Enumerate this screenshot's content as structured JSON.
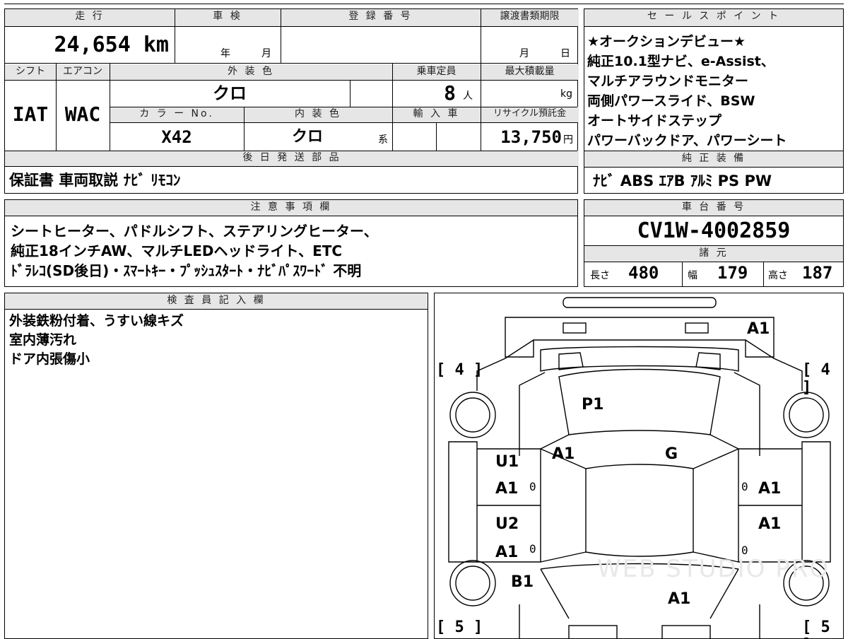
{
  "top": {
    "mileage_label": "走 行",
    "mileage_value": "24,654 km",
    "inspection_label": "車 検",
    "inspection_year": "年",
    "inspection_month": "月",
    "registration_label": "登 録 番 号",
    "transfer_label": "譲渡書類期限",
    "transfer_month": "月",
    "transfer_day": "日"
  },
  "specs": {
    "shift_label": "シフト",
    "ac_label": "エアコン",
    "exterior_label": "外 装 色",
    "capacity_label": "乗車定員",
    "maxload_label": "最大積載量",
    "shift_value": "IAT",
    "ac_value": "WAC",
    "exterior_value": "クロ",
    "capacity_value": "8",
    "capacity_unit": "人",
    "maxload_unit": "kg",
    "color_no_label": "カ ラ ー No.",
    "interior_label": "内 装 色",
    "import_label": "輸 入 車",
    "recycle_label": "リサイクル預託金",
    "color_no_value": "X42",
    "interior_value": "クロ",
    "interior_suffix": "系",
    "recycle_value": "13,750",
    "recycle_unit": "円"
  },
  "later_parts": {
    "label": "後 日 発 送 部 品",
    "items": "保証書 車両取説 ﾅﾋﾞ ﾘﾓｺﾝ"
  },
  "sales_point": {
    "label": "セ ー ル ス ポ イ ン ト",
    "lines": [
      "★オークションデビュー★",
      "純正10.1型ナビ、e-Assist、",
      "マルチアラウンドモニター",
      "両側パワースライド、BSW",
      "オートサイドステップ",
      "パワーバックドア、パワーシート"
    ]
  },
  "equipment": {
    "label": "純 正 装 備",
    "items": "ﾅﾋﾞ ABS ｴｱB ｱﾙﾐ PS PW"
  },
  "notes": {
    "label": "注 意 事 項 欄",
    "lines": [
      "シートヒーター、パドルシフト、ステアリングヒーター、",
      "純正18インチAW、マルチLEDヘッドライト、ETC",
      "ﾄﾞﾗﾚｺ(SD後日)・ｽﾏｰﾄｷｰ・ﾌﾟｯｼｭｽﾀｰﾄ・ﾅﾋﾞﾊﾟｽﾜｰﾄﾞ 不明"
    ]
  },
  "chassis": {
    "label": "車 台 番 号",
    "value": "CV1W-4002859"
  },
  "dimensions": {
    "label": "諸 元",
    "length_label": "長さ",
    "length_value": "480",
    "width_label": "幅",
    "width_value": "179",
    "height_label": "高さ",
    "height_value": "187"
  },
  "inspector": {
    "label": "検 査 員 記 入 欄",
    "lines": [
      "外装鉄粉付着、うすい線キズ",
      "室内薄汚れ",
      "ドア内張傷小"
    ]
  },
  "diagram": {
    "tire_fl": "[ 4 ]",
    "tire_fr": "[ 4 ]",
    "tire_rl": "[ 5 ]",
    "tire_rr": "[ 5 ]",
    "marks": {
      "bumper_front": "A1",
      "hood": "P1",
      "fender_left": "A1",
      "fender_right": "G",
      "door_fl_label": "U1",
      "door_fl_mark": "A1",
      "door_rl_label": "U2",
      "door_rl_mark": "A1",
      "door_fr_mark": "A1",
      "door_rr_mark": "A1",
      "quarter_rl": "B1",
      "rear": "A1",
      "zero": "0"
    },
    "watermark": "WEB STUDIO PRO"
  }
}
